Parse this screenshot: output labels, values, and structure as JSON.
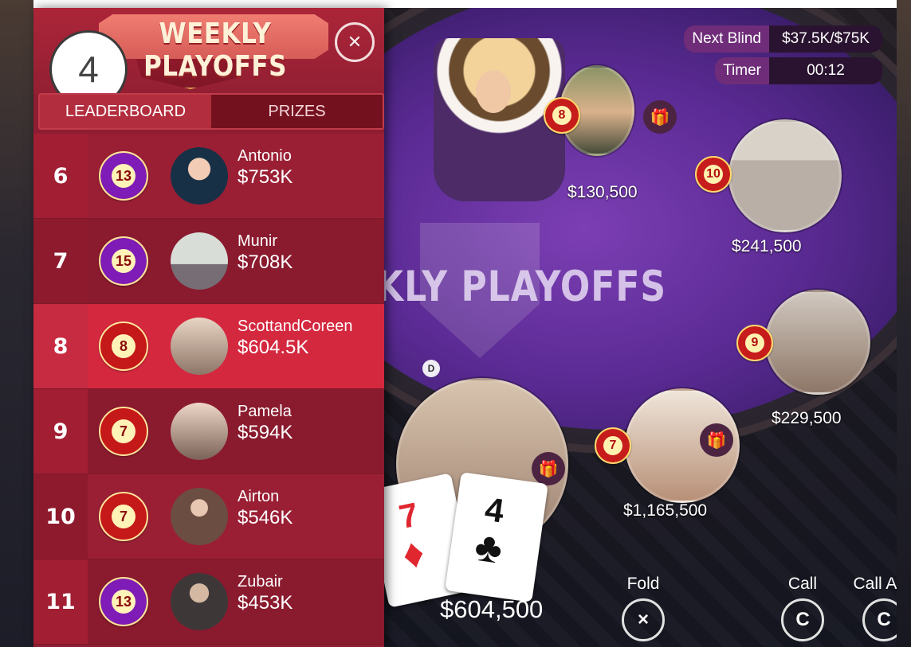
{
  "leaderboard": {
    "title": "WEEKLY PLAYOFFS",
    "tabs": [
      "LEADERBOARD",
      "PRIZES"
    ],
    "step_badge": "4",
    "rows": [
      {
        "rank": "6",
        "level": "13",
        "name": "Antonio",
        "amount": "$753K"
      },
      {
        "rank": "7",
        "level": "15",
        "name": "Munir",
        "amount": "$708K"
      },
      {
        "rank": "8",
        "level": "8",
        "name": "ScottandCoreen",
        "amount": "$604.5K"
      },
      {
        "rank": "9",
        "level": "7",
        "name": "Pamela",
        "amount": "$594K"
      },
      {
        "rank": "10",
        "level": "7",
        "name": "Airton",
        "amount": "$546K"
      },
      {
        "rank": "11",
        "level": "13",
        "name": "Zubair",
        "amount": "$453K"
      }
    ]
  },
  "table": {
    "logo_text": "KLY PLAYOFFS",
    "dealer_marker": "D",
    "next_blind_label": "Next Blind",
    "next_blind_value": "$37.5K/$75K",
    "timer_label": "Timer",
    "timer_value": "00:12",
    "players": [
      {
        "level": "8",
        "money": "$130,500"
      },
      {
        "level": "10",
        "money": "$241,500"
      },
      {
        "level": "9",
        "money": "$229,500"
      },
      {
        "level": "7",
        "money": "$1,165,500"
      }
    ],
    "self_money": "$604,500",
    "cards": [
      {
        "rank": "7",
        "suit": "♦"
      },
      {
        "rank": "4",
        "suit": "♣"
      }
    ],
    "actions": {
      "fold": "Fold",
      "call": "Call",
      "call_any": "Call Any",
      "fold_icon": "×",
      "call_icon": "C",
      "call_any_icon": "C"
    }
  },
  "colors": {
    "panel_bg": "#8f1d32",
    "highlight_row": "#d4283f",
    "felt": "#5a2a93"
  }
}
